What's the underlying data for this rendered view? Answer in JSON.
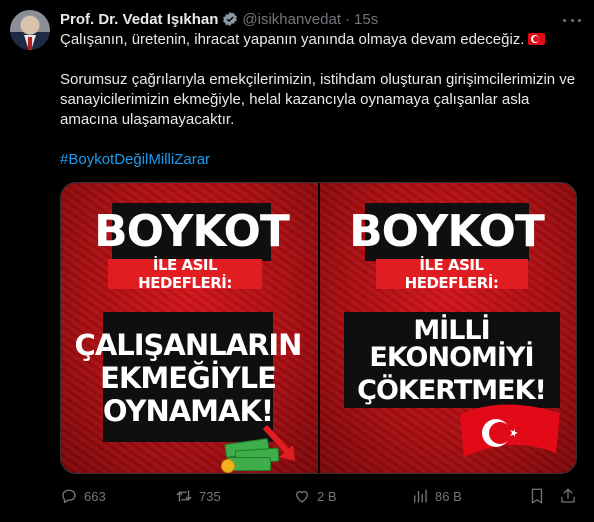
{
  "author": {
    "name": "Prof. Dr. Vedat Işıkhan",
    "handle": "@isikhanvedat",
    "time": "15s"
  },
  "tweet": {
    "line1": "Çalışanın, üretenin, ihracat yapanın yanında olmaya devam edeceğiz.",
    "line2": "Sorumsuz çağrılarıyla emekçilerimizin, istihdam oluşturan girişimcilerimizin ve sanayicilerimizin ekmeğiyle, helal kazancıyla oynamaya çalışanlar asla amacına ulaşamayacaktır.",
    "hashtag": "#BoykotDeğilMilliZarar"
  },
  "media": {
    "left": {
      "title": "BOYKOT",
      "subtitle": "İLE ASIL HEDEFLERİ:",
      "lines": [
        "ÇALIŞANLARIN",
        "EKMEĞİYLE",
        "OYNAMAK!"
      ]
    },
    "right": {
      "title": "BOYKOT",
      "subtitle": "İLE ASIL HEDEFLERİ:",
      "lines": [
        "MİLLİ EKONOMİYİ",
        "ÇÖKERTMEK!"
      ]
    }
  },
  "actions": {
    "reply_count": "663",
    "retweet_count": "735",
    "like_count": "2 B",
    "views_count": "86 B"
  },
  "colors": {
    "background": "#000000",
    "text": "#e7e9ea",
    "muted": "#71767b",
    "link": "#1d9bf0",
    "poster_red": "#d0141a",
    "band_red": "#e21d22"
  }
}
